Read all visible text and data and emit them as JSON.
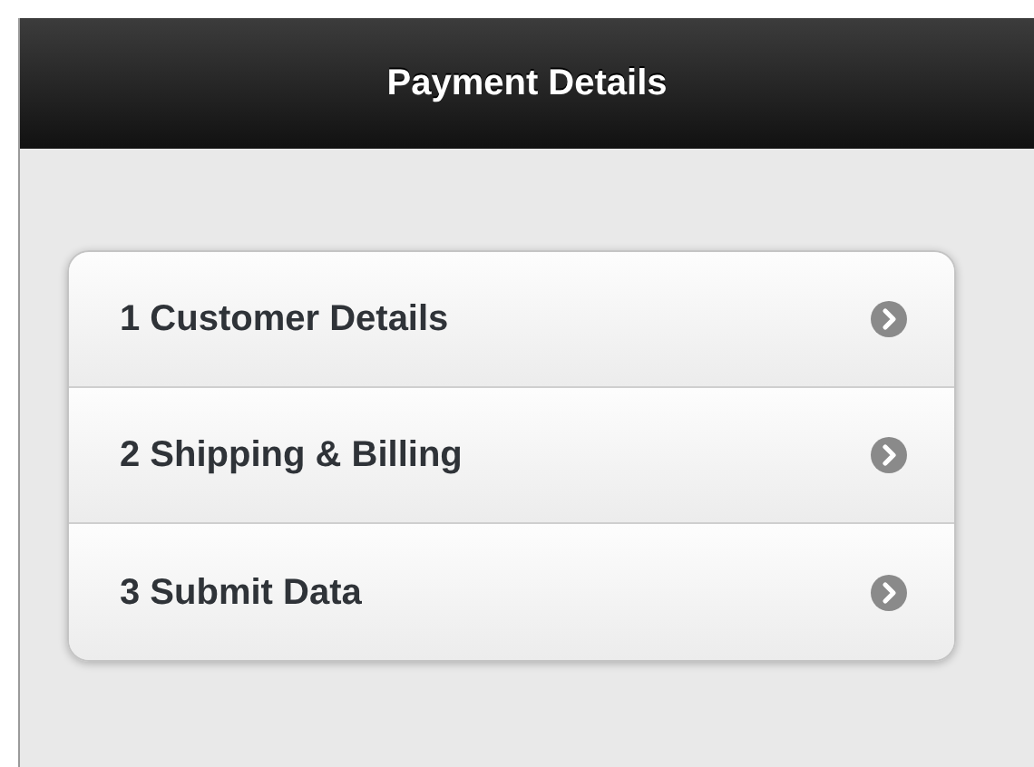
{
  "header": {
    "title": "Payment Details"
  },
  "steps": [
    {
      "label": "1 Customer Details"
    },
    {
      "label": "2 Shipping & Billing"
    },
    {
      "label": "3 Submit Data"
    }
  ]
}
